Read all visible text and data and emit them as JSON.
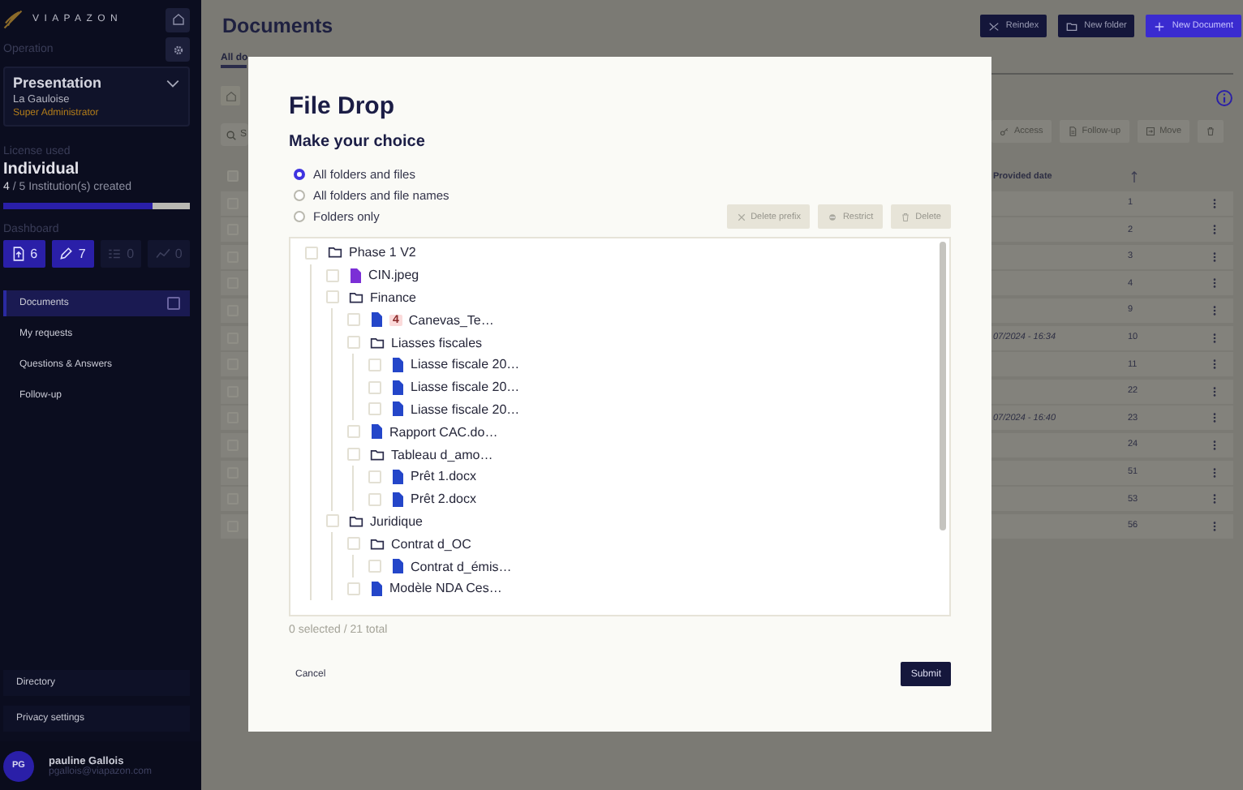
{
  "sidebar": {
    "brand": "VIAPAZON",
    "operation_label": "Operation",
    "workspace": {
      "name": "Presentation",
      "company": "La Gauloise",
      "role": "Super Administrator"
    },
    "license": {
      "label": "License used",
      "plan": "Individual",
      "used": "4",
      "total": "/ 5 Institution(s) created",
      "level": 0.8
    },
    "dashboard": {
      "label": "Dashboard",
      "tiles": [
        {
          "kind": "upload",
          "count": "6",
          "selected": true
        },
        {
          "kind": "edit",
          "count": "7",
          "selected": true
        },
        {
          "kind": "list",
          "count": "0",
          "selected": false
        },
        {
          "kind": "chart",
          "count": "0",
          "selected": false
        }
      ]
    },
    "menu": [
      {
        "label": "Documents",
        "selected": true
      },
      {
        "label": "My requests",
        "selected": false
      },
      {
        "label": "Questions & Answers",
        "selected": false
      },
      {
        "label": "Follow-up",
        "selected": false
      }
    ],
    "bottom_menu": [
      "Directory",
      "Privacy settings"
    ],
    "user": {
      "initials": "PG",
      "name": "pauline Gallois",
      "email": "pgallois@viapazon.com"
    }
  },
  "page": {
    "title": "Documents",
    "actions": [
      {
        "kind": "reindex",
        "label": "Reindex"
      },
      {
        "kind": "folder",
        "label": "New folder"
      },
      {
        "kind": "add",
        "label": "New Document"
      }
    ],
    "tab": "All do",
    "search_placeholder": "S",
    "toolbar": [
      {
        "kind": "access",
        "label": "Access"
      },
      {
        "kind": "follow",
        "label": "Follow-up"
      },
      {
        "kind": "move",
        "label": "Move"
      },
      {
        "kind": "trash"
      }
    ],
    "table": {
      "columns": [
        "Provided date"
      ],
      "all_checked": false,
      "rows": [
        {
          "checked": false,
          "number": "1"
        },
        {
          "checked": false,
          "number": "2"
        },
        {
          "checked": false,
          "number": "3"
        },
        {
          "checked": false,
          "number": "4"
        },
        {
          "checked": false,
          "number": "9"
        },
        {
          "checked": false,
          "provided_date": "07/2024 - 16:34",
          "number": "10"
        },
        {
          "checked": false,
          "number": "11"
        },
        {
          "checked": false,
          "number": "22"
        },
        {
          "checked": false,
          "provided_date": "07/2024 - 16:40",
          "number": "23"
        },
        {
          "checked": false,
          "number": "24"
        },
        {
          "checked": false,
          "number": "51"
        },
        {
          "checked": false,
          "number": "53"
        },
        {
          "checked": false,
          "number": "56"
        }
      ]
    }
  },
  "dialog": {
    "title": "File Drop",
    "subtitle": "Make your choice",
    "options": [
      {
        "label": "All folders and files",
        "selected": true
      },
      {
        "label": "All folders and file names",
        "selected": false
      },
      {
        "label": "Folders only",
        "selected": false
      }
    ],
    "actions": [
      {
        "kind": "close",
        "label": "Delete prefix"
      },
      {
        "kind": "restrict",
        "label": "Restrict"
      },
      {
        "kind": "trash",
        "label": "Delete"
      }
    ],
    "tree": [
      {
        "kind": "folder",
        "name": "Phase 1 V2",
        "checked": false,
        "children": [
          {
            "kind": "file",
            "name": "CIN.jpeg",
            "checked": false,
            "color": "#7b2fd6"
          },
          {
            "kind": "folder",
            "name": "Finance",
            "checked": false,
            "children": [
              {
                "kind": "file",
                "name": "Canevas_Te…",
                "checked": false,
                "color": "#2446c9",
                "badge": "4"
              },
              {
                "kind": "folder",
                "name": "Liasses fiscales",
                "checked": false,
                "children": [
                  {
                    "kind": "file",
                    "name": "Liasse fiscale 20…",
                    "checked": false,
                    "color": "#2446c9"
                  },
                  {
                    "kind": "file",
                    "name": "Liasse fiscale 20…",
                    "checked": false,
                    "color": "#2446c9"
                  },
                  {
                    "kind": "file",
                    "name": "Liasse fiscale 20…",
                    "checked": false,
                    "color": "#2446c9"
                  }
                ]
              },
              {
                "kind": "file",
                "name": "Rapport CAC.do…",
                "checked": false,
                "color": "#2446c9"
              },
              {
                "kind": "folder",
                "name": "Tableau d_amo…",
                "checked": false,
                "children": [
                  {
                    "kind": "file",
                    "name": "Prêt 1.docx",
                    "checked": false,
                    "color": "#2446c9"
                  },
                  {
                    "kind": "file",
                    "name": "Prêt 2.docx",
                    "checked": false,
                    "color": "#2446c9"
                  }
                ]
              }
            ]
          },
          {
            "kind": "folder",
            "name": "Juridique",
            "checked": false,
            "children": [
              {
                "kind": "folder",
                "name": "Contrat d_OC",
                "checked": false,
                "children": [
                  {
                    "kind": "file",
                    "name": "Contrat d_émis…",
                    "checked": false,
                    "color": "#2446c9"
                  }
                ]
              },
              {
                "kind": "file",
                "name": "Modèle NDA Ces…",
                "checked": false,
                "color": "#2446c9"
              }
            ]
          }
        ]
      }
    ],
    "summary": "0 selected / 21 total",
    "cancel": "Cancel",
    "submit": "Submit"
  }
}
